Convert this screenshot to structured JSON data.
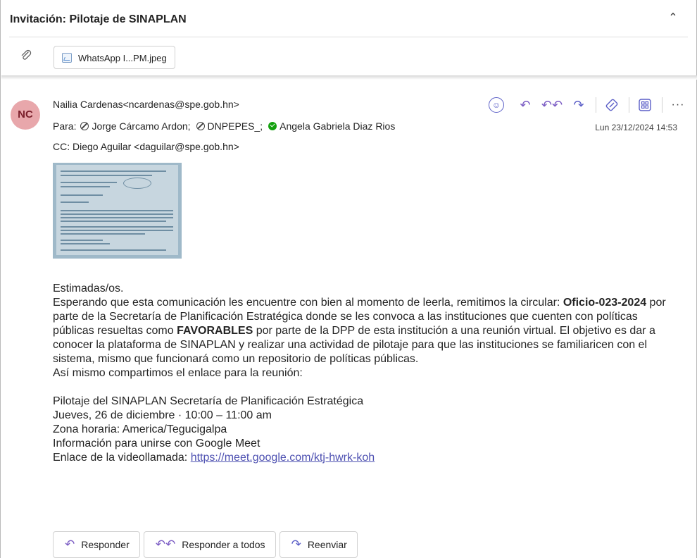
{
  "subject": "Invitación: Pilotaje de SINAPLAN",
  "attachment": {
    "name": "WhatsApp I...PM.jpeg"
  },
  "sender": {
    "initials": "NC",
    "from": "Nailia Cardenas<ncardenas@spe.gob.hn>"
  },
  "to_label": "Para:",
  "recipients": [
    {
      "name": "Jorge Cárcamo Ardon;",
      "status": "blocked"
    },
    {
      "name": "DNPEPES_;",
      "status": "blocked"
    },
    {
      "name": "Angela Gabriela Diaz Rios",
      "status": "ok"
    }
  ],
  "cc": "CC:  Diego Aguilar <daguilar@spe.gob.hn>",
  "date": "Lun 23/12/2024 14:53",
  "actions": {
    "smiley": "☺",
    "reply": "↶",
    "reply_all": "↶↶",
    "forward": "↷",
    "more": "···"
  },
  "body": {
    "greeting": "Estimadas/os.",
    "p1_a": "Esperando que esta comunicación les encuentre con bien al momento de leerla, remitimos la circular: ",
    "p1_b": "Oficio-023-2024",
    "p1_c": " por parte de la Secretaría de Planificación Estratégica donde se les convoca a las instituciones que cuenten con políticas públicas resueltas como ",
    "p1_d": "FAVORABLES",
    "p1_e": " por parte de la DPP de esta institución a una reunión virtual. El objetivo es dar a conocer la plataforma de SINAPLAN y realizar una actividad de pilotaje para que las instituciones se familiaricen con el sistema, mismo que funcionará como un repositorio de políticas públicas.",
    "p2": "Así mismo compartimos el enlace para la reunión:",
    "meeting_title": "Pilotaje del SINAPLAN Secretaría de Planificación Estratégica",
    "meeting_when": "Jueves, 26 de diciembre · 10:00 – 11:00 am",
    "meeting_tz": "Zona horaria: America/Tegucigalpa",
    "meeting_info": "Información para unirse con Google Meet",
    "link_label": "Enlace de la videollamada: ",
    "link_url": "https://meet.google.com/ktj-hwrk-koh"
  },
  "buttons": {
    "reply": "Responder",
    "reply_all": "Responder a todos",
    "forward": "Reenviar"
  }
}
